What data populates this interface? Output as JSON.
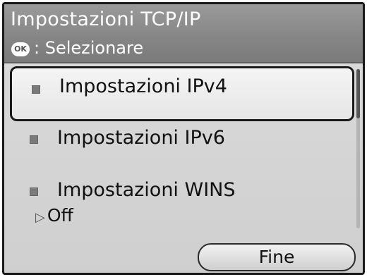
{
  "header": {
    "title": "Impostazioni TCP/IP",
    "hint_icon": "OK",
    "hint_text": ": Selezionare"
  },
  "menu": {
    "items": [
      {
        "label": "Impostazioni IPv4",
        "selected": true
      },
      {
        "label": "Impostazioni IPv6",
        "selected": false
      },
      {
        "label": "Impostazioni WINS",
        "selected": false,
        "value": "Off"
      }
    ]
  },
  "footer": {
    "done_label": "Fine"
  }
}
